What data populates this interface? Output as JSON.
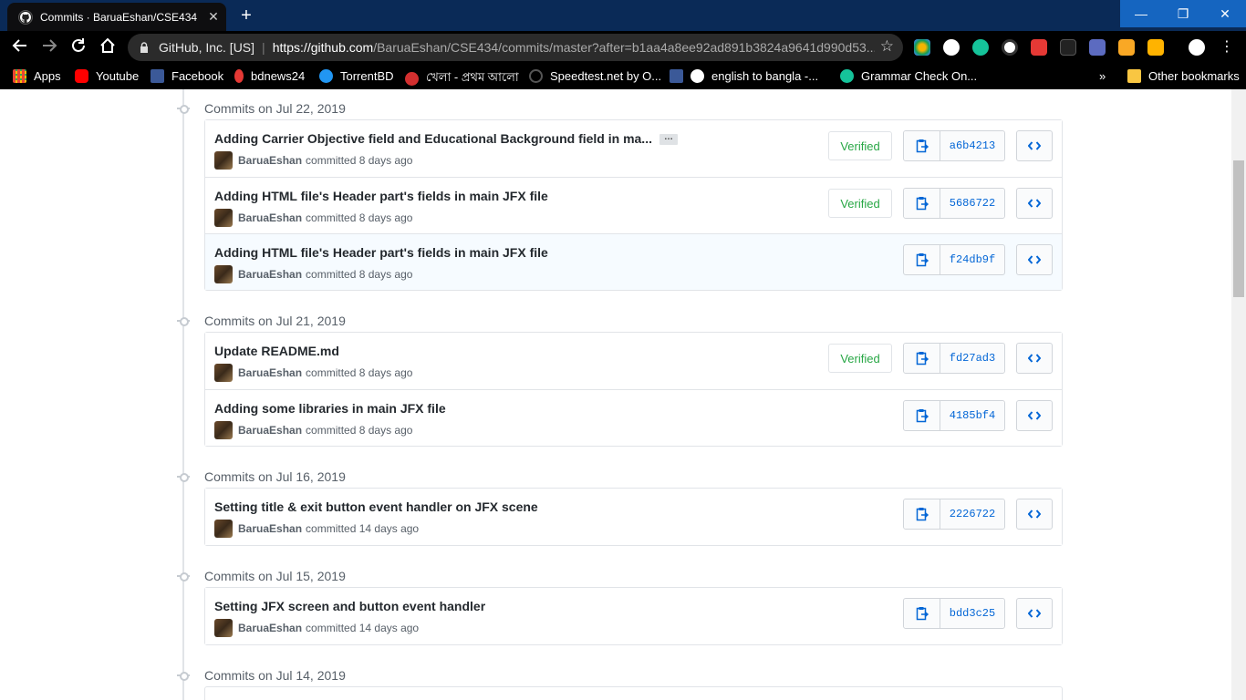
{
  "browser": {
    "tab_title": "Commits · BaruaEshan/CSE434",
    "tab_close": "✕",
    "new_tab": "+",
    "window_controls": {
      "minimize": "—",
      "maximize": "❐",
      "close": "✕"
    },
    "site_identity": "GitHub, Inc. [US]",
    "url_domain": "https://github.com",
    "url_path": "/BaruaEshan/CSE434/commits/master?after=b1aa4a8ee92ad891b3824a9641d990d53...",
    "bookmarks": [
      {
        "label": "Apps",
        "icon": "apps-grid-icon",
        "color": "#4285f4"
      },
      {
        "label": "Youtube",
        "icon": "youtube-icon",
        "color": "#ff0000"
      },
      {
        "label": "Facebook",
        "icon": "facebook-icon",
        "color": "#3b5998"
      },
      {
        "label": "bdnews24",
        "icon": "bdnews24-icon",
        "color": "#e53935"
      },
      {
        "label": "TorrentBD",
        "icon": "torrentbd-icon",
        "color": "#2196f3"
      },
      {
        "label": "খেলা - প্রথম আলো",
        "icon": "prothomalo-icon",
        "color": "#d32f2f"
      },
      {
        "label": "Speedtest.net by O...",
        "icon": "speedtest-icon",
        "color": "#333333"
      },
      {
        "label": "english to bangla -...",
        "icon": "facebook-icon",
        "color": "#3b5998"
      },
      {
        "label": "Grammar Check On...",
        "icon": "google-icon",
        "color": "#ffffff"
      },
      {
        "label": "Grammar Check On...",
        "icon": "grammarly-icon",
        "color": "#15c39a"
      }
    ],
    "bookmark_overflow": "»",
    "other_bookmarks": "Other bookmarks",
    "accent_colors": {
      "titlebar": "#0a2a57",
      "window_buttons": "#1565c0"
    }
  },
  "commit_groups": [
    {
      "date": "Commits on Jul 22, 2019",
      "commits": [
        {
          "title": "Adding Carrier Objective field and Educational Background field in ma...",
          "has_ellipsis": true,
          "author": "BaruaEshan",
          "when": "committed 8 days ago",
          "verified": "Verified",
          "sha": "a6b4213"
        },
        {
          "title": "Adding HTML file's Header part's fields in main JFX file",
          "author": "BaruaEshan",
          "when": "committed 8 days ago",
          "verified": "Verified",
          "sha": "5686722"
        },
        {
          "title": "Adding HTML file's Header part's fields in main JFX file",
          "author": "BaruaEshan",
          "when": "committed 8 days ago",
          "sha": "f24db9f"
        }
      ]
    },
    {
      "date": "Commits on Jul 21, 2019",
      "commits": [
        {
          "title": "Update README.md",
          "author": "BaruaEshan",
          "when": "committed 8 days ago",
          "verified": "Verified",
          "sha": "fd27ad3"
        },
        {
          "title": "Adding some libraries in main JFX file",
          "author": "BaruaEshan",
          "when": "committed 8 days ago",
          "sha": "4185bf4"
        }
      ]
    },
    {
      "date": "Commits on Jul 16, 2019",
      "commits": [
        {
          "title": "Setting title & exit button event handler on JFX scene",
          "author": "BaruaEshan",
          "when": "committed 14 days ago",
          "sha": "2226722"
        }
      ]
    },
    {
      "date": "Commits on Jul 15, 2019",
      "commits": [
        {
          "title": "Setting JFX screen and button event handler",
          "author": "BaruaEshan",
          "when": "committed 14 days ago",
          "sha": "bdd3c25"
        }
      ]
    },
    {
      "date": "Commits on Jul 14, 2019",
      "commits": []
    }
  ],
  "ui": {
    "ellipsis_label": "…",
    "browse_label": "<>"
  }
}
